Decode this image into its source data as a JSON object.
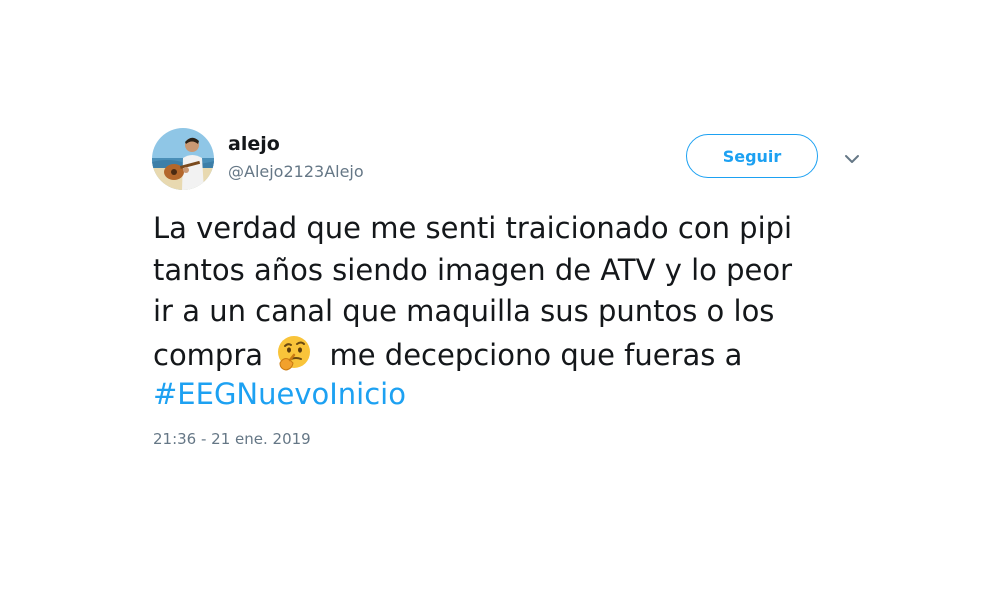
{
  "user": {
    "display_name": "alejo",
    "handle": "@Alejo2123Alejo",
    "avatar_icon": "guitar-player-avatar"
  },
  "actions": {
    "follow_label": "Seguir",
    "menu_icon": "chevron-down-icon"
  },
  "tweet": {
    "line1": "La verdad que me senti traicionado con pipi",
    "line2": "tantos años siendo imagen de ATV y lo peor",
    "line3": "ir a un canal que maquilla sus puntos  o los",
    "line4_before": "compra",
    "line4_emoji": "thinking-face-emoji",
    "line4_after": "me decepciono que fueras a",
    "hashtag": "#EEGNuevoInicio",
    "timestamp": "21:36 - 21 ene. 2019"
  },
  "colors": {
    "accent": "#1da1f2",
    "text": "#14171a",
    "secondary": "#657786"
  }
}
